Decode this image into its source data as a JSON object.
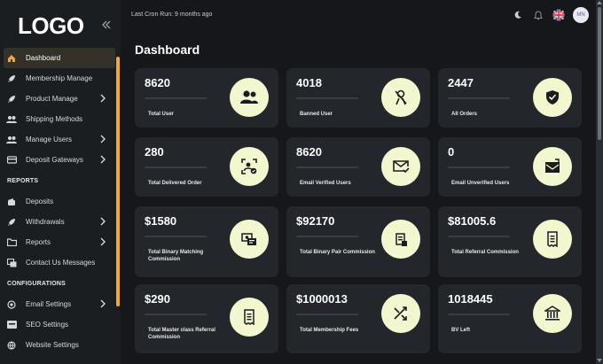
{
  "sidebar": {
    "logo": "LOGO",
    "items": [
      {
        "label": "Dashboard",
        "icon": "home-icon",
        "active": true
      },
      {
        "label": "Membership Manage",
        "icon": "rocket-icon"
      },
      {
        "label": "Product Manage",
        "icon": "rocket-icon",
        "chevron": true
      },
      {
        "label": "Shipping Methods",
        "icon": "users-icon"
      },
      {
        "label": "Manage Users",
        "icon": "users-icon",
        "chevron": true
      },
      {
        "label": "Deposit Gateways",
        "icon": "card-icon",
        "chevron": true
      }
    ],
    "reports_heading": "REPORTS",
    "report_items": [
      {
        "label": "Deposits",
        "icon": "wallet-icon"
      },
      {
        "label": "Withdrawals",
        "icon": "rocket-icon",
        "chevron": true
      },
      {
        "label": "Reports",
        "icon": "folder-icon",
        "chevron": true
      },
      {
        "label": "Contact Us Messages",
        "icon": "message-icon"
      }
    ],
    "config_heading": "CONFIGURATIONS",
    "config_items": [
      {
        "label": "Email Settings",
        "icon": "at-icon",
        "chevron": true
      },
      {
        "label": "SEO Settings",
        "icon": "seo-icon"
      },
      {
        "label": "Website Settings",
        "icon": "globe-icon"
      }
    ]
  },
  "header": {
    "cron_text": "Last Cron Run: 9 months ago",
    "avatar_initials": "MN",
    "icons": [
      "moon-icon",
      "bell-icon",
      "uk-flag-icon"
    ]
  },
  "main": {
    "title": "Dashboard",
    "cards": [
      {
        "value": "8620",
        "label": "Total User",
        "icon": "users-icon"
      },
      {
        "value": "4018",
        "label": "Banned User",
        "icon": "user-banned-icon"
      },
      {
        "value": "2447",
        "label": "All Orders",
        "icon": "shield-check-icon"
      },
      {
        "value": "280",
        "label": "Total Delivered Order",
        "icon": "delivered-icon"
      },
      {
        "value": "8620",
        "label": "Email Verified Users",
        "icon": "mail-check-icon"
      },
      {
        "value": "0",
        "label": "Email Unverified Users",
        "icon": "mail-open-icon"
      },
      {
        "value": "$1580",
        "label": "Total Binary Matching Commission",
        "icon": "money-icon"
      },
      {
        "value": "$92170",
        "label": "Total Binary Pair Commission",
        "icon": "receipt-icon"
      },
      {
        "value": "$81005.6",
        "label": "Total Referral Commission",
        "icon": "receipt-icon"
      },
      {
        "value": "$290",
        "label": "Total Master class Referral Commission",
        "icon": "receipt-icon"
      },
      {
        "value": "$1000013",
        "label": "Total Membership Fees",
        "icon": "shuffle-icon"
      },
      {
        "value": "1018445",
        "label": "BV Left",
        "icon": "bank-icon"
      }
    ]
  },
  "colors": {
    "accent": "#f2a93b",
    "card_bg": "#23262b",
    "icon_circle": "#f2f7d0",
    "page_bg": "#15171a"
  }
}
